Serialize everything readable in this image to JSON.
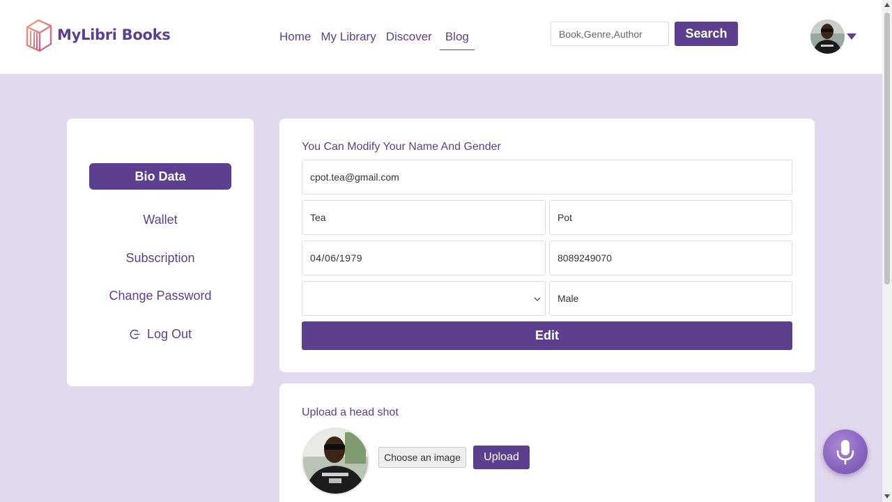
{
  "brand": {
    "name": "MyLibri Books"
  },
  "nav": [
    {
      "label": "Home"
    },
    {
      "label": "My Library"
    },
    {
      "label": "Discover"
    },
    {
      "label": "Blog",
      "active": true
    }
  ],
  "search": {
    "placeholder": "Book,Genre,Author",
    "button_label": "Search"
  },
  "sidebar": {
    "items": [
      {
        "label": "Bio Data",
        "active": true
      },
      {
        "label": "Wallet"
      },
      {
        "label": "Subscription"
      },
      {
        "label": "Change Password"
      },
      {
        "label": "Log Out",
        "icon": "logout-icon"
      }
    ]
  },
  "bio_form": {
    "title": "You Can Modify Your Name And Gender",
    "email": "cpot.tea@gmail.com",
    "first_name": "Tea",
    "last_name": "Pot",
    "dob": "04/06/1979",
    "phone": "8089249070",
    "select_value": "",
    "gender": "Male",
    "edit_label": "Edit"
  },
  "upload": {
    "title": "Upload a head shot",
    "choose_label": "Choose an image",
    "upload_label": "Upload"
  },
  "colors": {
    "primary": "#5c3f8f",
    "background": "#e3d9ef",
    "card": "#ffffff"
  },
  "icons": {
    "mic": "microphone-icon",
    "caret": "caret-down-icon",
    "logout": "logout-icon"
  }
}
